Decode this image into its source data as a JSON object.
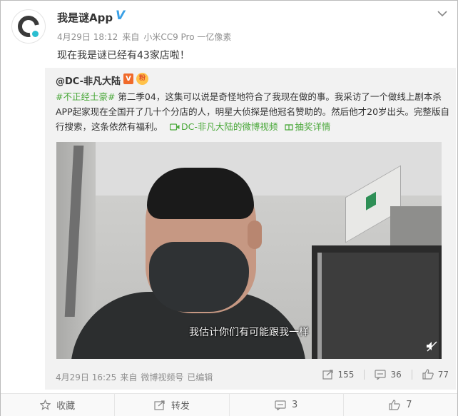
{
  "post": {
    "author": "我是谜App",
    "verified_badge": "V",
    "date": "4月29日 18:12",
    "source_prefix": "来自",
    "source": "小米CC9 Pro 一亿像素",
    "text": "现在我是谜已经有43家店啦！"
  },
  "repost": {
    "user": "@DC-非凡大陆",
    "badge_v": "V",
    "badge_fan": "粉",
    "topic": "#不正经土豪#",
    "body": " 第二季04，这集可以说是奇怪地符合了我现在做的事。我采访了一个做线上剧本杀APP起家现在全国开了几十个分店的人，明星大侦探是他冠名赞助的。然后他才20岁出头。完整版自行搜索，这条依然有福利。",
    "video_link": "DC-非凡大陆的微博视频",
    "lottery_link": "抽奖详情",
    "video_subtitle": "我估计你们有可能跟我一样",
    "date": "4月29日 16:25",
    "source_prefix": "来自",
    "source": "微博视频号",
    "edited": "已编辑",
    "reposts": "155",
    "comments": "36",
    "likes": "77"
  },
  "footer": {
    "favorite": "收藏",
    "repost": "转发",
    "comments": "3",
    "likes": "7"
  },
  "colors": {
    "link_green": "#4aa83a",
    "verified_blue": "#3aa0e6",
    "meta_gray": "#8f8f8f"
  },
  "icons": [
    "app-logo-icon",
    "verified-icon",
    "chevron-down-icon",
    "video-camera-icon",
    "gift-icon",
    "mute-icon",
    "repost-icon",
    "comment-icon",
    "like-icon",
    "star-icon"
  ]
}
